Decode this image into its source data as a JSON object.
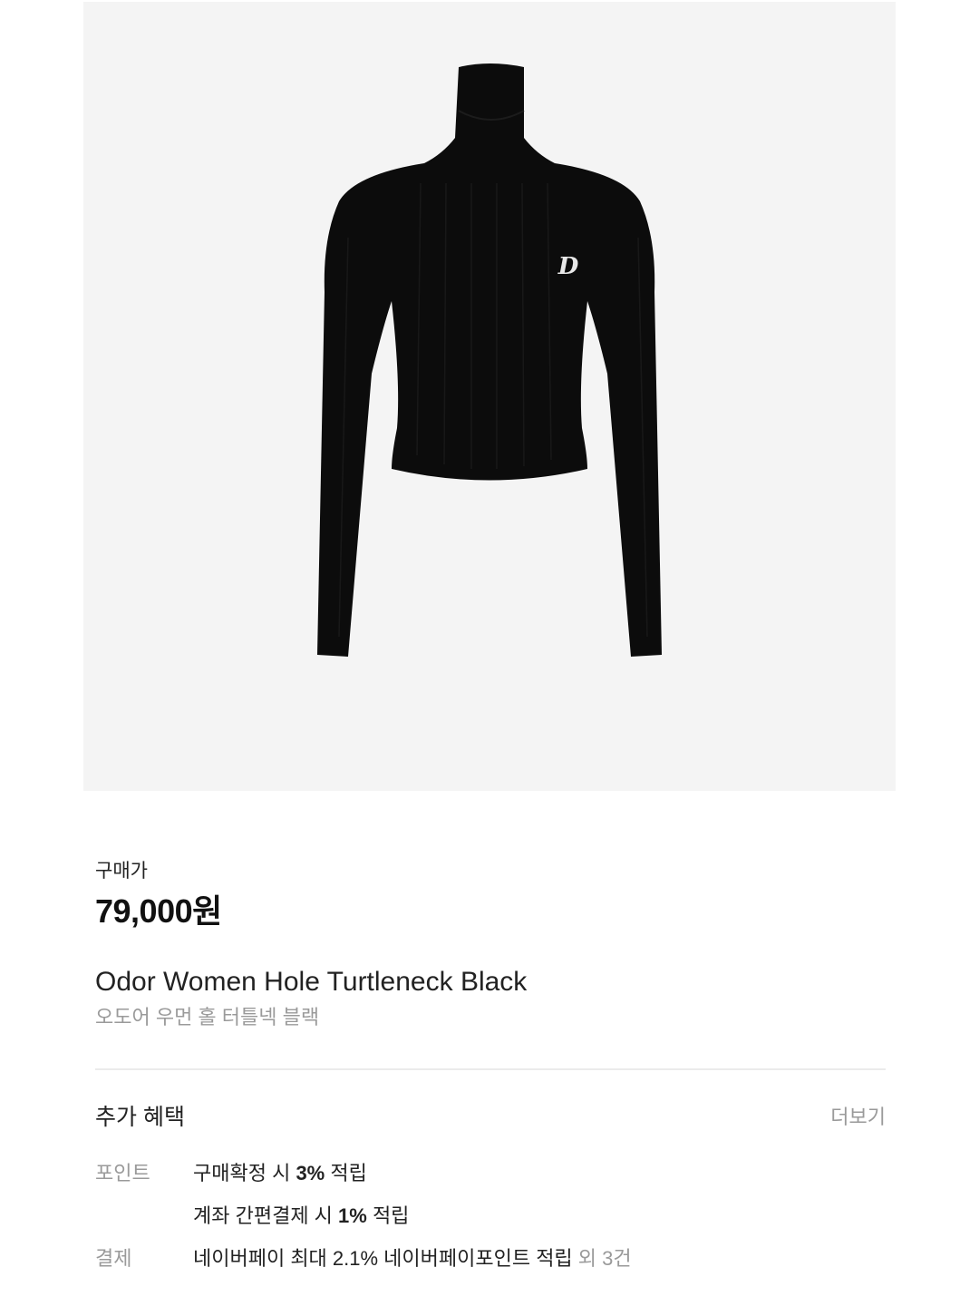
{
  "product": {
    "image_alt": "Black ribbed cropped turtleneck with D logo",
    "logo_letter": "D",
    "price_label": "구매가",
    "price": "79,000원",
    "name_en": "Odor Women Hole Turtleneck Black",
    "name_ko": "오도어 우먼 홀 터틀넥 블랙"
  },
  "benefits": {
    "title": "추가 혜택",
    "more_label": "더보기",
    "rows": [
      {
        "label": "포인트",
        "pre": "구매확정 시 ",
        "bold": "3%",
        "post": " 적립",
        "extra": ""
      },
      {
        "label": "",
        "pre": "계좌 간편결제 시 ",
        "bold": "1%",
        "post": " 적립",
        "extra": ""
      },
      {
        "label": "결제",
        "pre": "네이버페이 최대 2.1% 네이버페이포인트 적립",
        "bold": "",
        "post": "",
        "extra": " 외 3건"
      }
    ]
  },
  "colors": {
    "image_bg": "#f4f4f4",
    "garment": "#0c0c0c",
    "muted_text": "#9a9a9a",
    "divider": "#ebebeb"
  }
}
